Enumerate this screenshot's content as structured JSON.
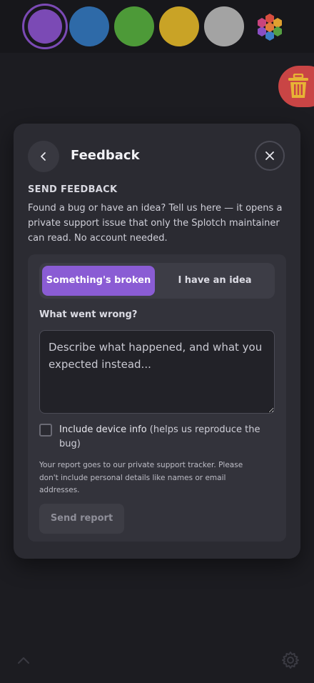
{
  "palette": {
    "swatches": [
      {
        "name": "purple",
        "color": "#7b4ab5",
        "selected": true
      },
      {
        "name": "blue",
        "color": "#2e6aa8",
        "selected": false
      },
      {
        "name": "green",
        "color": "#4d9a38",
        "selected": false
      },
      {
        "name": "yellow",
        "color": "#c9a326",
        "selected": false
      },
      {
        "name": "gray",
        "color": "#a3a3a3",
        "selected": false
      }
    ],
    "custom_icon": "hexagon-palette-icon"
  },
  "trash": {
    "icon": "trash-icon",
    "color": "#c94545"
  },
  "feedback": {
    "title": "Feedback",
    "back_icon": "chevron-left-icon",
    "close_icon": "close-icon",
    "heading": "SEND FEEDBACK",
    "intro": "Found a bug or have an idea? Tell us here — it opens a private support issue that only the Splotch maintainer can read. No account needed.",
    "tabs": [
      {
        "label": "Something's broken",
        "active": true
      },
      {
        "label": "I have an idea",
        "active": false
      }
    ],
    "field_label": "What went wrong?",
    "textarea": {
      "value": "",
      "placeholder": "Describe what happened, and what you expected instead..."
    },
    "device_info": {
      "checked": false,
      "label_strong": "Include device info",
      "label_rest": " (helps us reproduce the bug)"
    },
    "note": "Your report goes to our private support tracker. Please don't include personal details like names or email addresses.",
    "send_label": "Send report",
    "accent": "#8a5cd4"
  },
  "bottom": {
    "left_icon": "chevron-up-icon",
    "right_icon": "gear-icon"
  }
}
